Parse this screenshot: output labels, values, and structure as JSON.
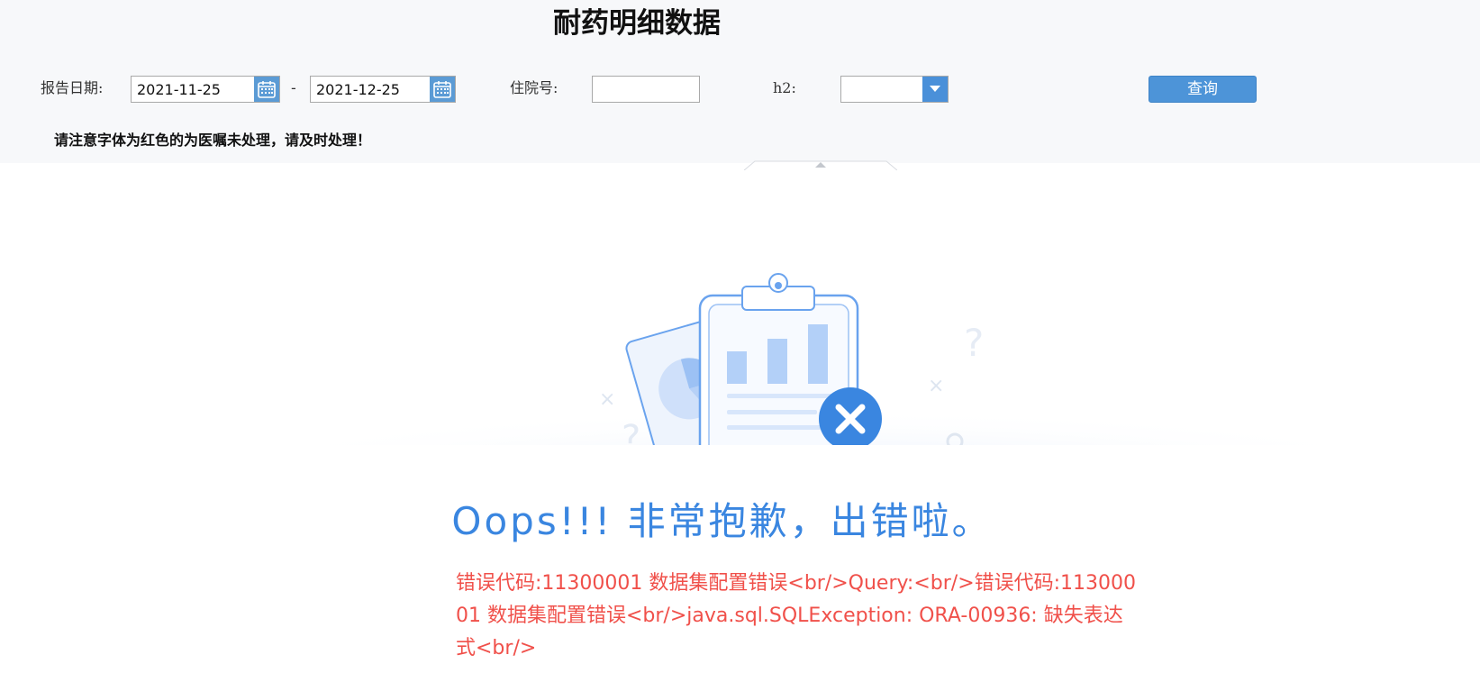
{
  "header": {
    "title": "耐药明细数据"
  },
  "filters": {
    "report_date_label": "报告日期:",
    "date_from": "2021-11-25",
    "date_separator": "-",
    "date_to": "2021-12-25",
    "admission_no_label": "住院号:",
    "admission_no_value": "",
    "h2_label": "h2:",
    "h2_value": "",
    "query_button": "查询"
  },
  "notice": "请注意字体为红色的为医嘱未处理，请及时处理！",
  "error": {
    "title": "Oops!!! 非常抱歉，出错啦。",
    "message": "错误代码:11300001 数据集配置错误<br/>Query:<br/>错误代码:11300001 数据集配置错误<br/>java.sql.SQLException: ORA-00936: 缺失表达式<br/>"
  },
  "icons": {
    "calendar": "calendar-icon",
    "dropdown": "chevron-down-icon",
    "collapse": "collapse-up-icon",
    "error": "close-circle-icon"
  },
  "colors": {
    "accent": "#4d94d8",
    "error_title": "#3a86e0",
    "error_text": "#f0504a",
    "panel_bg": "#f7f8fa"
  }
}
